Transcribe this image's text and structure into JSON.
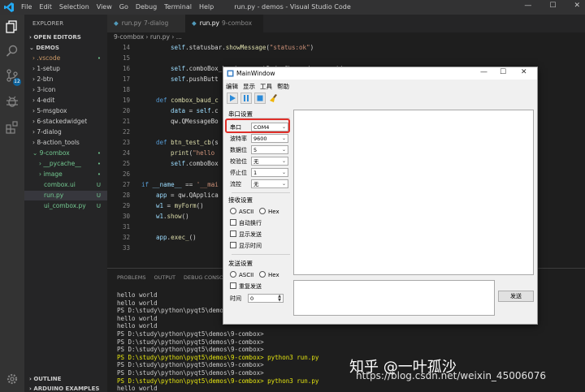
{
  "titlebar": {
    "menu": [
      "File",
      "Edit",
      "Selection",
      "View",
      "Go",
      "Debug",
      "Terminal",
      "Help"
    ],
    "title": "run.py - demos - Visual Studio Code",
    "minimize": "—",
    "maximize": "☐",
    "close": "✕"
  },
  "activity": {
    "scm_badge": "12"
  },
  "sidebar": {
    "explorer_title": "EXPLORER",
    "open_editors": "OPEN EDITORS",
    "demos": "DEMOS",
    "items": [
      {
        "label": ".vscode",
        "status": "•"
      },
      {
        "label": "1-setup",
        "status": ""
      },
      {
        "label": "2-btn",
        "status": ""
      },
      {
        "label": "3-icon",
        "status": ""
      },
      {
        "label": "4-edit",
        "status": ""
      },
      {
        "label": "5-msgbox",
        "status": ""
      },
      {
        "label": "6-stackedwidget",
        "status": ""
      },
      {
        "label": "7-dialog",
        "status": ""
      },
      {
        "label": "8-action_tools",
        "status": ""
      },
      {
        "label": "9-combox",
        "status": "•"
      },
      {
        "label": "__pycache__",
        "status": "•"
      },
      {
        "label": "image",
        "status": "•"
      },
      {
        "label": "combox.ui",
        "status": "U"
      },
      {
        "label": "run.py",
        "status": "U"
      },
      {
        "label": "ui_combox.py",
        "status": "U"
      }
    ],
    "outline": "OUTLINE",
    "arduino": "ARDUINO EXAMPLES"
  },
  "tabs": [
    {
      "label": "run.py",
      "hint": "7-dialog"
    },
    {
      "label": "run.py",
      "hint": "9-combox"
    }
  ],
  "breadcrumb": "9-combox  ›  run.py  ›  ...",
  "editor": {
    "line_numbers": [
      "14",
      "15",
      "16",
      "17",
      "18",
      "19",
      "20",
      "21",
      "22",
      "23",
      "24",
      "25",
      "26",
      "27",
      "28",
      "29",
      "30",
      "31",
      "32",
      "33"
    ]
  },
  "panel": {
    "tabs": [
      "PROBLEMS",
      "OUTPUT",
      "DEBUG CONSO"
    ],
    "terminal_lines": [
      "hello world",
      "hello world",
      "PS D:\\study\\python\\pyqt5\\demo",
      "hello world",
      "hello world",
      "PS D:\\study\\python\\pyqt5\\demos\\9-combox>",
      "PS D:\\study\\python\\pyqt5\\demos\\9-combox>",
      "PS D:\\study\\python\\pyqt5\\demos\\9-combox>",
      "PS D:\\study\\python\\pyqt5\\demos\\9-combox> python3 run.py",
      "PS D:\\study\\python\\pyqt5\\demos\\9-combox>",
      "PS D:\\study\\python\\pyqt5\\demos\\9-combox>",
      "PS D:\\study\\python\\pyqt5\\demos\\9-combox> python3 run.py",
      "hello world",
      "▯"
    ]
  },
  "watermark": {
    "line1": "知乎 @一叶孤沙",
    "line2": "https://blog.csdn.net/weixin_45006076"
  },
  "qt": {
    "title": "MainWindow",
    "menu": [
      "编辑",
      "显示",
      "工具",
      "帮助"
    ],
    "serial_group": "串口设置",
    "fields": [
      {
        "label": "串口",
        "value": "COM4"
      },
      {
        "label": "波特率",
        "value": "9600"
      },
      {
        "label": "数据位",
        "value": "5"
      },
      {
        "label": "校验位",
        "value": "无"
      },
      {
        "label": "停止位",
        "value": "1"
      },
      {
        "label": "流控",
        "value": "无"
      }
    ],
    "recv_group": "接收设置",
    "recv_ascii": "ASCII",
    "recv_hex": "Hex",
    "auto_wrap": "自动换行",
    "show_send": "显示发送",
    "show_time": "显示时间",
    "send_group": "发送设置",
    "send_ascii": "ASCII",
    "send_hex": "Hex",
    "repeat_send": "重复发送",
    "time_label": "时间",
    "time_value": "0",
    "send_button": "发送"
  }
}
